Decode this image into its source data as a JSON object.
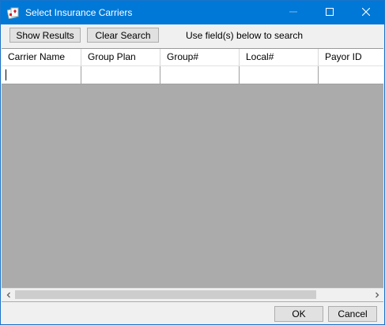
{
  "window": {
    "title": "Select Insurance Carriers",
    "title_bar_color": "#0078d7"
  },
  "icons": {
    "app": "app-cards-icon",
    "minimize": "minimize-icon",
    "maximize": "maximize-icon",
    "close": "close-icon",
    "scroll_left": "chevron-left-icon",
    "scroll_right": "chevron-right-icon"
  },
  "toolbar": {
    "show_results_label": "Show Results",
    "clear_search_label": "Clear Search",
    "hint": "Use field(s) below to search"
  },
  "grid": {
    "columns": [
      "Carrier Name",
      "Group Plan",
      "Group#",
      "Local#",
      "Payor ID"
    ],
    "filter_values": [
      "",
      "",
      "",
      "",
      ""
    ],
    "empty_area_color": "#ababab"
  },
  "footer": {
    "ok_label": "OK",
    "cancel_label": "Cancel"
  }
}
